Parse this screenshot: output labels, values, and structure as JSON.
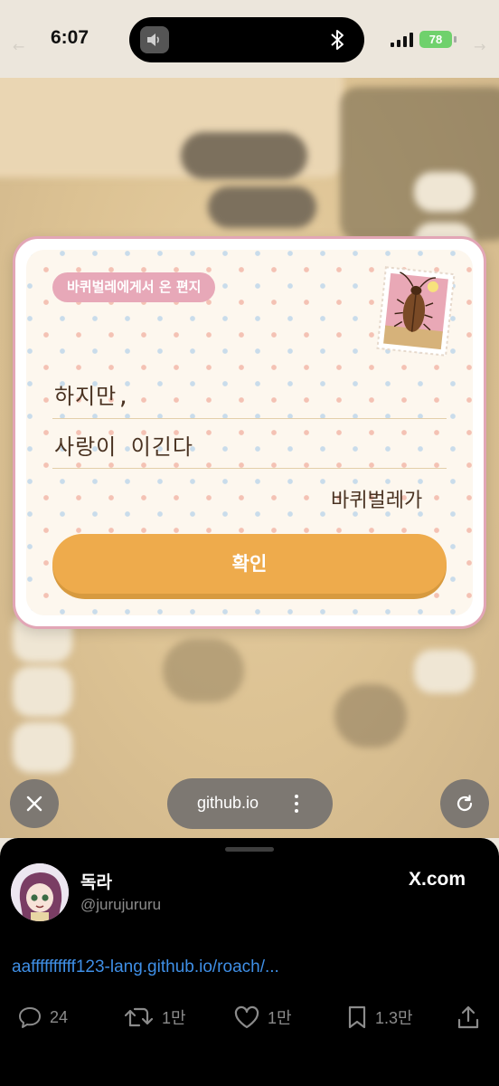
{
  "status_bar": {
    "time": "6:07",
    "battery": "78"
  },
  "letter": {
    "badge": "바퀴벌레에게서 온 편지",
    "line1": "하지만,",
    "line2": "사랑이 이긴다",
    "signature": "바퀴벌레가",
    "confirm_label": "확인"
  },
  "browser": {
    "url": "github.io"
  },
  "tweet": {
    "display_name": "독라",
    "handle": "@jurujururu",
    "brand": "X.com",
    "link": "aaffffffffff123-lang.github.io/roach/...",
    "actions": {
      "replies": "24",
      "retweets": "1만",
      "likes": "1만",
      "bookmarks": "1.3만"
    }
  },
  "colors": {
    "accent_orange": "#eeab4c",
    "letter_pink": "#e7a8b8",
    "link_blue": "#3f8fe6",
    "battery_green": "#6fd16c"
  },
  "icons": [
    "speaker-icon",
    "bluetooth-icon",
    "signal-icon",
    "battery-icon",
    "close-icon",
    "more-icon",
    "reload-icon",
    "reply-icon",
    "retweet-icon",
    "like-icon",
    "bookmark-icon",
    "share-icon",
    "stamp-icon"
  ]
}
